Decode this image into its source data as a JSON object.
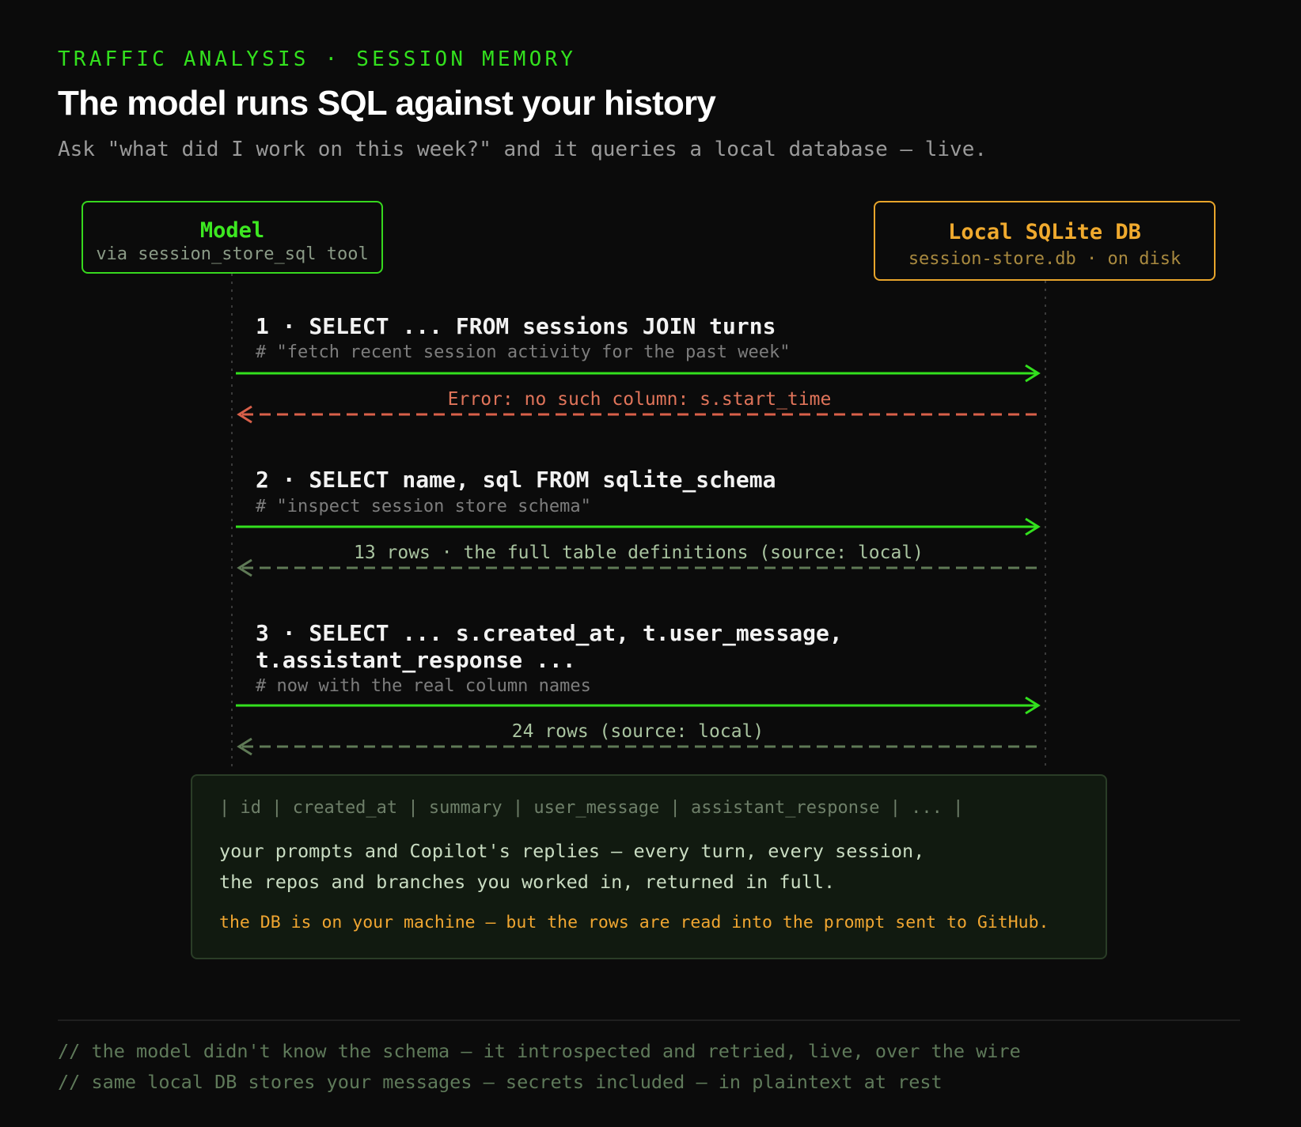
{
  "header": {
    "eyebrow": "TRAFFIC ANALYSIS · SESSION MEMORY",
    "title": "The model runs SQL against your history",
    "subtitle": "Ask \"what did I work on this week?\" and it queries a local database — live."
  },
  "actors": {
    "model": {
      "name": "Model",
      "sub": "via session_store_sql tool"
    },
    "db": {
      "name": "Local SQLite DB",
      "sub": "session-store.db · on disk"
    }
  },
  "steps": [
    {
      "query": "1 · SELECT ... FROM sessions JOIN turns",
      "note": "# \"fetch recent session activity for the past week\"",
      "response": "Error: no such column: s.start_time",
      "status": "error"
    },
    {
      "query": "2 · SELECT name, sql FROM sqlite_schema",
      "note": "# \"inspect session store schema\"",
      "response": "13 rows · the full table definitions (source: local)",
      "status": "ok"
    },
    {
      "query_line1": "3 · SELECT ... s.created_at, t.user_message,",
      "query_line2": "t.assistant_response ...",
      "note": "# now with the real column names",
      "response": "24 rows (source: local)",
      "status": "ok"
    }
  ],
  "result": {
    "header": "| id | created_at | summary | user_message | assistant_response | ... |",
    "line1": "your prompts and Copilot's replies — every turn, every session,",
    "line2": "the repos and branches you worked in, returned in full.",
    "warning": "the DB is on your machine — but the rows are read into the prompt sent to GitHub."
  },
  "footer": {
    "line1": "// the model didn't know the schema — it introspected and retried, live, over the wire",
    "line2": "// same local DB stores your messages — secrets included — in plaintext at rest"
  },
  "colors": {
    "request": "#33e01e",
    "error": "#d9604a",
    "ok": "#5f7a56",
    "lifeline": "#3a3a3a"
  }
}
